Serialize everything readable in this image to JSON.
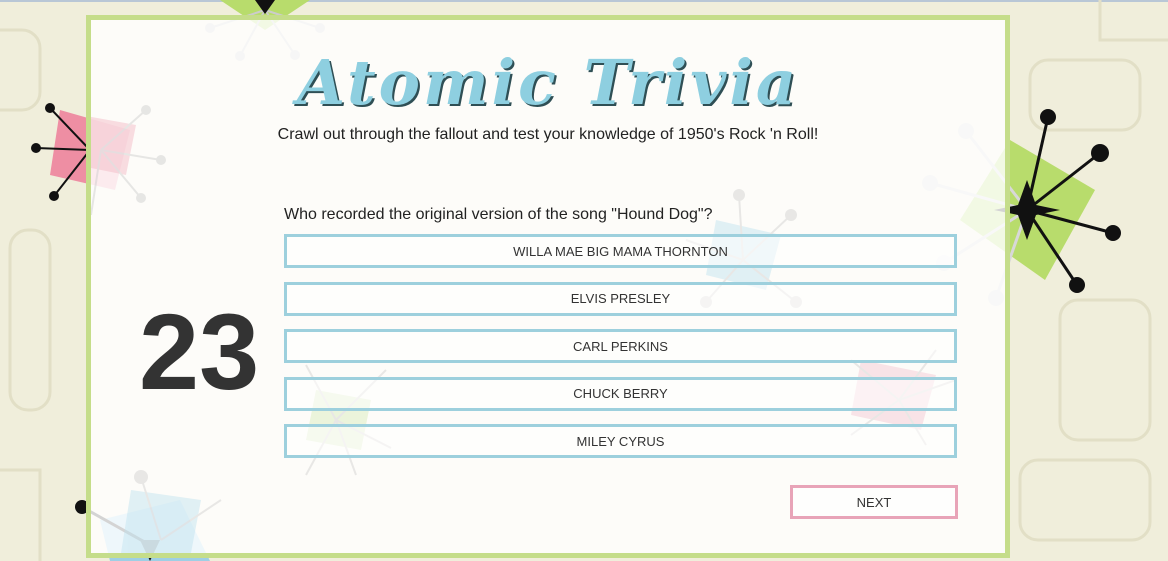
{
  "header": {
    "title": "Atomic Trivia",
    "subtitle": "Crawl out through the fallout and test your knowledge of 1950's Rock 'n Roll!"
  },
  "timer": {
    "seconds": "23"
  },
  "quiz": {
    "question": "Who recorded the original version of the song \"Hound Dog\"?",
    "answers": [
      {
        "label": "WILLA MAE BIG MAMA THORNTON"
      },
      {
        "label": "ELVIS PRESLEY"
      },
      {
        "label": "CARL PERKINS"
      },
      {
        "label": "CHUCK BERRY"
      },
      {
        "label": "MILEY CYRUS"
      }
    ],
    "next_label": "NEXT"
  },
  "colors": {
    "background": "#f0eedb",
    "panel_border": "#c5dd8a",
    "title": "#8ecfe0",
    "answer_border": "#9dd0dd",
    "next_border": "#e8a4b8"
  }
}
